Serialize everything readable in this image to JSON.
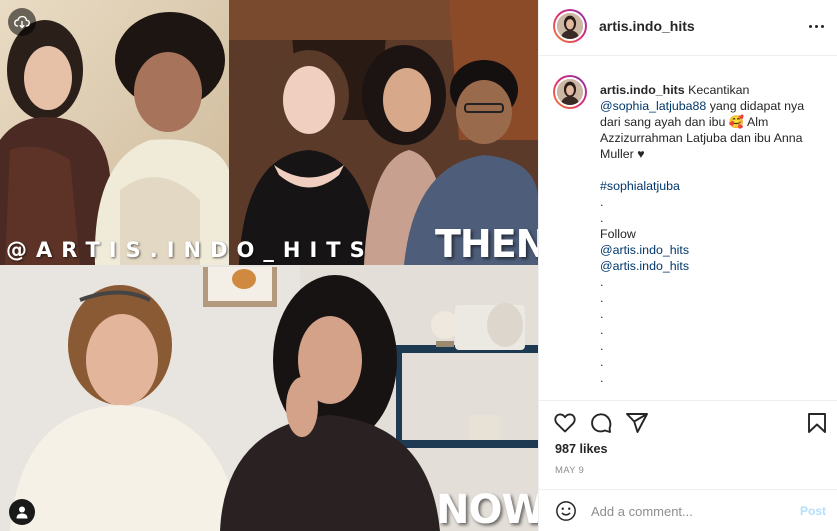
{
  "post": {
    "username": "artis.indo_hits",
    "caption": {
      "username": "artis.indo_hits",
      "text_1": "Kecantikan",
      "mention_1": "@sophia_latjuba88",
      "text_2": " yang didapat nya dari sang ayah dan ibu ",
      "emoji_1": "🥰",
      "text_3": " Alm Azzizurrahman Latjuba dan ibu Anna Muller ",
      "emoji_2": "♥",
      "hashtag": "#sophialatjuba",
      "dot": ".",
      "follow_label": "Follow",
      "mention_2": "@artis.indo_hits",
      "mention_3": "@artis.indo_hits"
    },
    "likes": "987 likes",
    "date": "MAY 9"
  },
  "media": {
    "watermark_handle": "@ARTIS.INDO_HITS",
    "label_then": "THEN",
    "label_now": "NOW",
    "cloud_icon": "cloud-download-icon",
    "person_icon": "person-tag-icon"
  },
  "comment": {
    "placeholder": "Add a comment...",
    "post_label": "Post"
  },
  "icons": {
    "like": "heart-icon",
    "comment": "comment-bubble-icon",
    "share": "paper-plane-icon",
    "save": "bookmark-icon",
    "emoji": "smiley-icon",
    "more": "more-horizontal-icon"
  },
  "colors": {
    "link": "#00376b",
    "muted": "#8e8e8e",
    "post_disabled": "#b2dffc",
    "border": "#efefef"
  }
}
